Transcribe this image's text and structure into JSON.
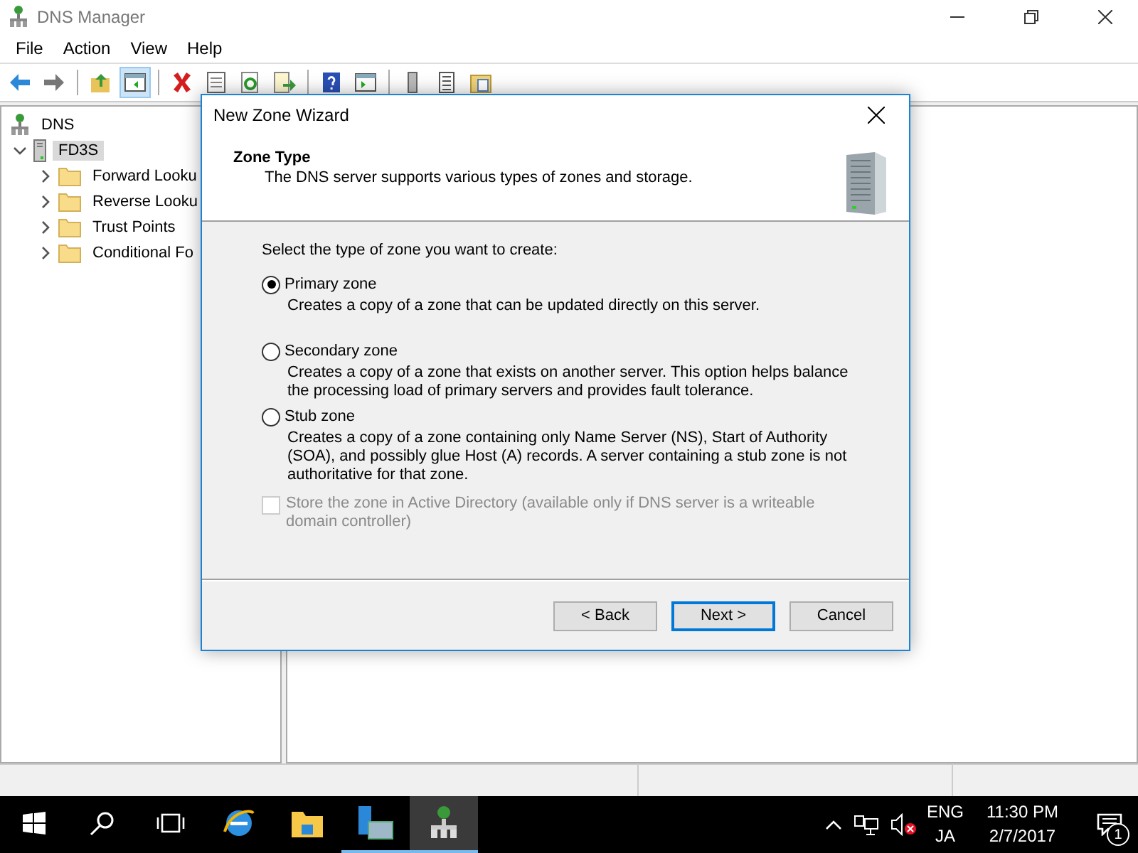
{
  "window": {
    "title": "DNS Manager"
  },
  "menu": [
    "File",
    "Action",
    "View",
    "Help"
  ],
  "toolbar": [
    {
      "kind": "back",
      "selected": false
    },
    {
      "kind": "forward",
      "selected": false
    },
    {
      "kind": "sep"
    },
    {
      "kind": "up",
      "selected": false
    },
    {
      "kind": "tree",
      "selected": true
    },
    {
      "kind": "sep"
    },
    {
      "kind": "delete",
      "selected": false
    },
    {
      "kind": "properties",
      "selected": false
    },
    {
      "kind": "refresh",
      "selected": false
    },
    {
      "kind": "export",
      "selected": false
    },
    {
      "kind": "sep"
    },
    {
      "kind": "help",
      "selected": false
    },
    {
      "kind": "pane",
      "selected": false
    },
    {
      "kind": "sep"
    },
    {
      "kind": "server",
      "selected": false
    },
    {
      "kind": "list",
      "selected": false
    },
    {
      "kind": "zone",
      "selected": false
    }
  ],
  "tree": {
    "label": "DNS",
    "children": [
      {
        "label": "FD3S",
        "expanded": true,
        "selected": true,
        "children": [
          {
            "label": "Forward Looku",
            "expanded": false,
            "selected": false
          },
          {
            "label": "Reverse Looku",
            "expanded": false,
            "selected": false
          },
          {
            "label": "Trust Points",
            "expanded": false,
            "selected": false
          },
          {
            "label": "Conditional Fo",
            "expanded": false,
            "selected": false
          }
        ]
      }
    ]
  },
  "dialog": {
    "title": "New Zone Wizard",
    "heading": "Zone Type",
    "subheading": "The DNS server supports various types of zones and storage.",
    "prompt": "Select the type of zone you want to create:",
    "options": [
      {
        "label": "Primary zone",
        "description": "Creates a copy of a zone that can be updated directly on this server.",
        "selected": true
      },
      {
        "label": "Secondary zone",
        "description": "Creates a copy of a zone that exists on another server. This option helps balance the processing load of primary servers and provides fault tolerance.",
        "selected": false
      },
      {
        "label": "Stub zone",
        "description": "Creates a copy of a zone containing only Name Server (NS), Start of Authority (SOA), and possibly glue Host (A) records. A server containing a stub zone is not authoritative for that zone.",
        "selected": false
      }
    ],
    "checkbox": {
      "label": "Store the zone in Active Directory (available only if DNS server is a writeable domain controller)",
      "checked": false,
      "disabled": true
    },
    "buttons": [
      {
        "label": "< Back",
        "default": false
      },
      {
        "label": "Next >",
        "default": true
      },
      {
        "label": "Cancel",
        "default": false
      }
    ]
  },
  "taskbar": {
    "apps": [
      {
        "kind": "browser",
        "running": false,
        "active": false
      },
      {
        "kind": "folder",
        "running": false,
        "active": false
      },
      {
        "kind": "server-manager",
        "running": true,
        "active": false
      },
      {
        "kind": "dns",
        "running": true,
        "active": true
      }
    ],
    "language": [
      "ENG",
      "JA"
    ],
    "time": "11:30 PM",
    "date": "2/7/2017",
    "notifications": "1"
  }
}
